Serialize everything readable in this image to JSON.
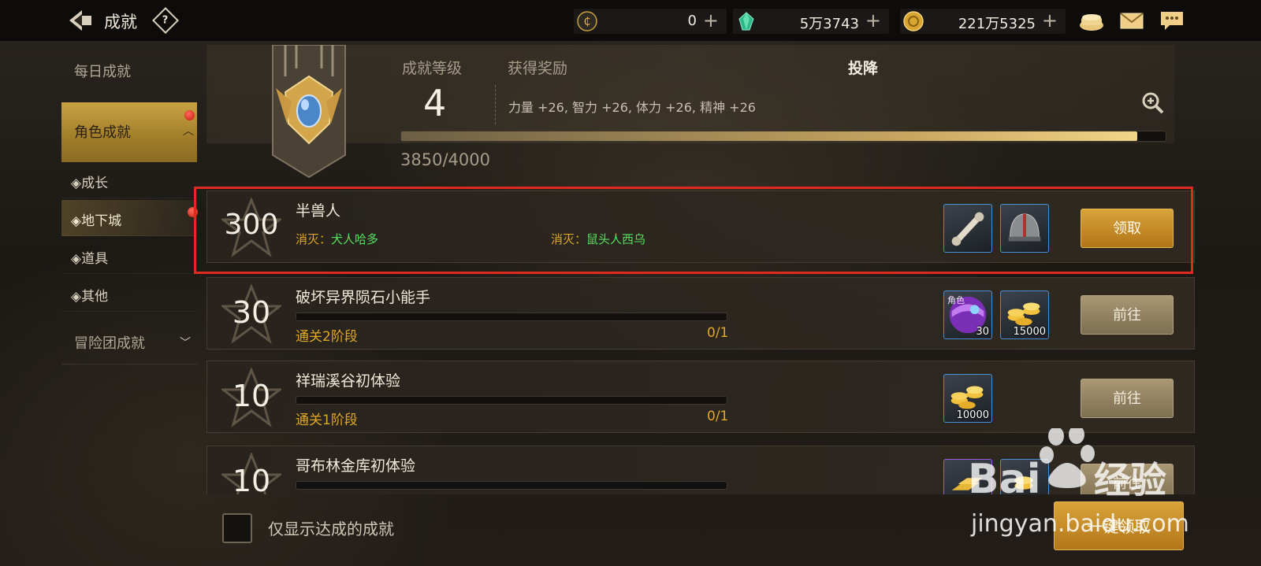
{
  "topbar": {
    "title": "成就",
    "help_glyph": "?",
    "currencies": [
      {
        "icon": "credit-coin-icon",
        "value": "0",
        "plus": "+"
      },
      {
        "icon": "green-crystal-icon",
        "value": "5万3743",
        "plus": "+"
      },
      {
        "icon": "gold-coin-icon",
        "value": "221万5325",
        "plus": "+"
      }
    ],
    "right_icons": [
      "bag-icon",
      "mail-icon",
      "chat-icon"
    ]
  },
  "sidebar": {
    "daily": "每日成就",
    "character": "角色成就",
    "subs": [
      "◈成长",
      "◈地下城",
      "◈道具",
      "◈其他"
    ],
    "adventure": "冒险团成就"
  },
  "header": {
    "level_label": "成就等级",
    "level": "4",
    "reward_label": "获得奖励",
    "title_name": "投降",
    "reward_text": "力量 +26, 智力 +26, 体力 +26, 精神 +26",
    "exp_text": "3850/4000",
    "exp_progress": 0.9625
  },
  "achievements": [
    {
      "points": "300",
      "name": "半兽人",
      "sub_conditions": [
        {
          "key": "消灭：",
          "value": "犬人哈多"
        },
        {
          "key": "消灭：",
          "value": "鼠头人西乌"
        }
      ],
      "rewards": [
        {
          "icon": "bone-item-icon",
          "qty": ""
        },
        {
          "icon": "helmet-item-icon",
          "qty": ""
        }
      ],
      "button": "领取"
    },
    {
      "points": "30",
      "name": "破坏异界陨石小能手",
      "condition": "通关2阶段",
      "count": "0/1",
      "progress": 0,
      "rewards": [
        {
          "icon": "purple-ticket-icon",
          "qty": "30",
          "badge": "角色"
        },
        {
          "icon": "gold-stack-icon",
          "qty": "15000"
        }
      ],
      "button": "前往"
    },
    {
      "points": "10",
      "name": "祥瑞溪谷初体验",
      "condition": "通关1阶段",
      "count": "0/1",
      "progress": 0,
      "rewards": [
        {
          "icon": "gold-stack-icon",
          "qty": "10000"
        }
      ],
      "button": "前往"
    },
    {
      "points": "10",
      "name": "哥布林金库初体验",
      "rewards": [
        {
          "icon": "gold-bars-icon",
          "qty": ""
        },
        {
          "icon": "gold-stack-icon",
          "qty": ""
        }
      ],
      "button": "前往"
    }
  ],
  "bottom": {
    "checkbox_label": "仅显示达成的成就",
    "button": "一键领取"
  },
  "watermark": {
    "logo": "Baidu经验",
    "url": "jingyan.baidu.com"
  },
  "colors": {
    "gold_button": "#c48b28",
    "highlight": "#e02a20",
    "condition": "#e0a822",
    "target": "#56e05e"
  }
}
